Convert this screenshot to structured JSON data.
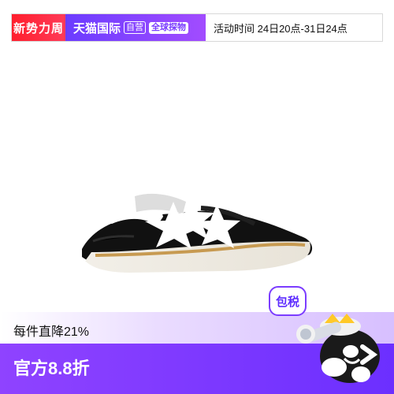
{
  "banner": {
    "badge": "新势力周",
    "brand": "天猫国际",
    "tag_self": "自营",
    "tag_global": "全球探物",
    "activity_time": "活动时间 24日20点-31日24点"
  },
  "product": {
    "image_label": "black sneakers with white stars"
  },
  "promo": {
    "discount": "每件直降21%",
    "price": "官方8.8折",
    "tax_badge": "包税"
  },
  "colors": {
    "red": "#ff2638",
    "purple": "#7a3cff",
    "lavender": "#e3d2ff"
  }
}
